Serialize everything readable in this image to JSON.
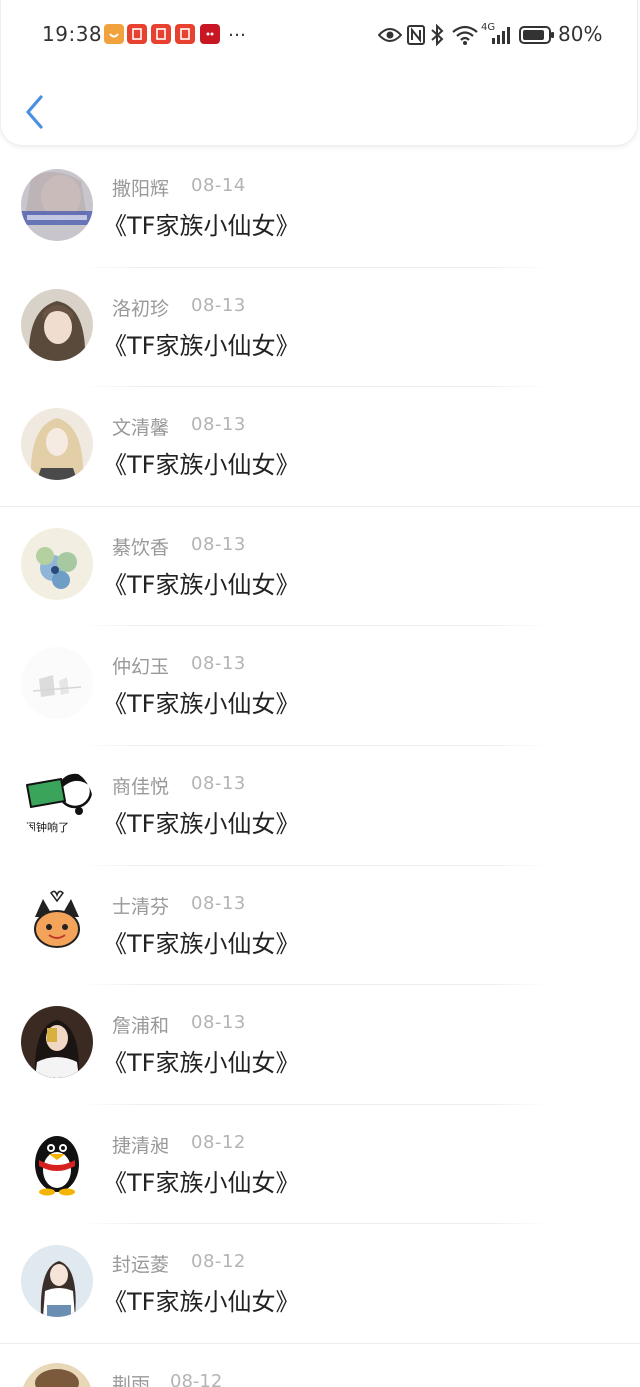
{
  "status_bar": {
    "time": "19:38",
    "more_indicator": "…",
    "battery_percent": "80%",
    "network": "4G",
    "app_icons": [
      "taobao-style-icon",
      "app-red-icon",
      "app-red-icon",
      "app-red-icon",
      "tmall-icon"
    ],
    "system_icons": [
      "eye-icon",
      "nfc-icon",
      "bluetooth-icon",
      "wifi-icon",
      "signal-icon",
      "battery-icon"
    ]
  },
  "header": {
    "back_icon": "chevron-left-icon",
    "accent_color": "#4a90e2"
  },
  "list": {
    "items": [
      {
        "name": "撒阳辉",
        "date": "08-14",
        "message": "《TF家族小仙女》",
        "avatar": "avatar-girl-photo"
      },
      {
        "name": "洛初珍",
        "date": "08-13",
        "message": "《TF家族小仙女》",
        "avatar": "avatar-girl-photo"
      },
      {
        "name": "文清馨",
        "date": "08-13",
        "message": "《TF家族小仙女》",
        "avatar": "avatar-anime-figure"
      },
      {
        "name": "綦饮香",
        "date": "08-13",
        "message": "《TF家族小仙女》",
        "avatar": "avatar-flower"
      },
      {
        "name": "仲幻玉",
        "date": "08-13",
        "message": "《TF家族小仙女》",
        "avatar": "avatar-light-sketch"
      },
      {
        "name": "商佳悦",
        "date": "08-13",
        "message": "《TF家族小仙女》",
        "avatar": "avatar-cartoon-sticker"
      },
      {
        "name": "士清芬",
        "date": "08-13",
        "message": "《TF家族小仙女》",
        "avatar": "avatar-cartoon-cat"
      },
      {
        "name": "詹浦和",
        "date": "08-13",
        "message": "《TF家族小仙女》",
        "avatar": "avatar-girl-photo-dark"
      },
      {
        "name": "捷清昶",
        "date": "08-12",
        "message": "《TF家族小仙女》",
        "avatar": "avatar-qq-penguin"
      },
      {
        "name": "封运菱",
        "date": "08-12",
        "message": "《TF家族小仙女》",
        "avatar": "avatar-girl-photo-light"
      }
    ],
    "partial_item": {
      "name": "荆雨",
      "date": "08-12"
    },
    "sticker_text": "闹钟响了"
  }
}
